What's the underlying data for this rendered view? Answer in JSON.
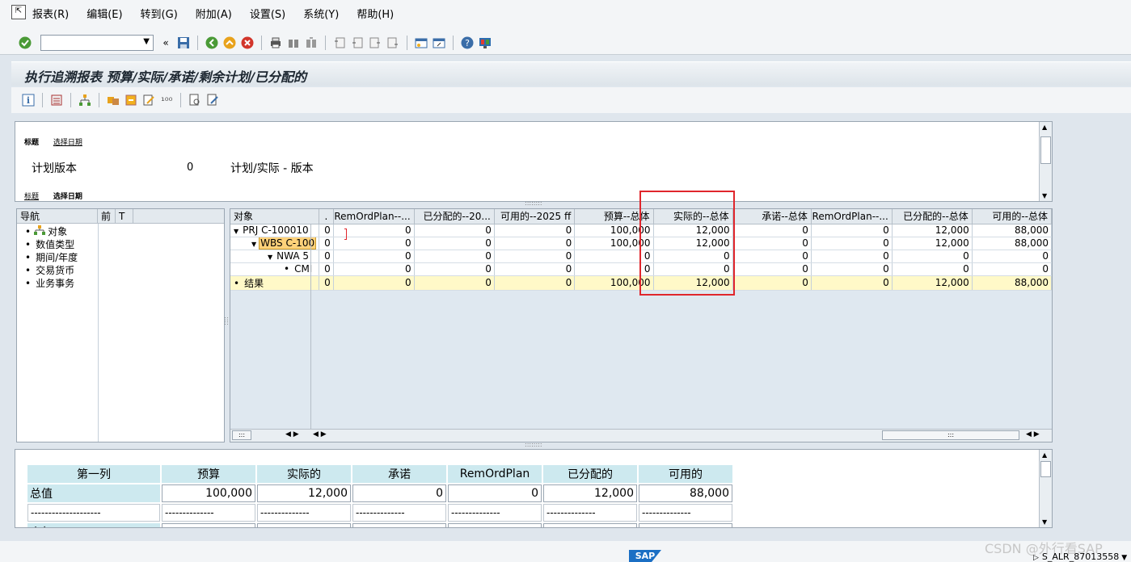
{
  "menu": [
    "报表(R)",
    "编辑(E)",
    "转到(G)",
    "附加(A)",
    "设置(S)",
    "系统(Y)",
    "帮助(H)"
  ],
  "title": "执行追溯报表 预算/实际/承诺/剩余计划/已分配的",
  "header": {
    "tab1_title": "标题",
    "tab1_link": "选择日期",
    "plan_version_label": "计划版本",
    "plan_version_value": "0",
    "plan_version_desc": "计划/实际 - 版本",
    "tab2_link": "标题",
    "tab2_title": "选择日期"
  },
  "nav": {
    "headers": [
      "导航",
      "前",
      "T"
    ],
    "items": [
      "对象",
      "数值类型",
      "期间/年度",
      "交易货币",
      "业务事务"
    ]
  },
  "grid": {
    "columns": [
      "对象",
      ".",
      "RemOrdPlan--...",
      "已分配的--20...",
      "可用的--2025 ff",
      "预算--总体",
      "实际的--总体",
      "承诺--总体",
      "RemOrdPlan--...",
      "已分配的--总体",
      "可用的--总体"
    ],
    "rows": [
      {
        "obj": "PRJ C-100010",
        "c": [
          "0",
          "0",
          "0",
          "0",
          "100,000",
          "12,000",
          "0",
          "0",
          "12,000",
          "88,000"
        ]
      },
      {
        "obj": "WBS C-100",
        "c": [
          "0",
          "0",
          "0",
          "0",
          "100,000",
          "12,000",
          "0",
          "0",
          "12,000",
          "88,000"
        ]
      },
      {
        "obj": "NWA 5",
        "c": [
          "0",
          "0",
          "0",
          "0",
          "0",
          "0",
          "0",
          "0",
          "0",
          "0"
        ]
      },
      {
        "obj": "CMI",
        "c": [
          "0",
          "0",
          "0",
          "0",
          "0",
          "0",
          "0",
          "0",
          "0",
          "0"
        ]
      },
      {
        "obj": "结果",
        "c": [
          "0",
          "0",
          "0",
          "0",
          "100,000",
          "12,000",
          "0",
          "0",
          "12,000",
          "88,000"
        ]
      }
    ]
  },
  "summary": {
    "headers": [
      "第一列",
      "预算",
      "实际的",
      "承诺",
      "RemOrdPlan",
      "已分配的",
      "可用的"
    ],
    "total_label": "总值",
    "total_values": [
      "100,000",
      "12,000",
      "0",
      "0",
      "12,000",
      "88,000"
    ],
    "dash_first": "--------------------",
    "dash_other": "--------------",
    "partial_label": "小年"
  },
  "status": {
    "system": "S_ALR_87013558",
    "logo": "SAP",
    "watermark": "CSDN @外行看SAP"
  }
}
